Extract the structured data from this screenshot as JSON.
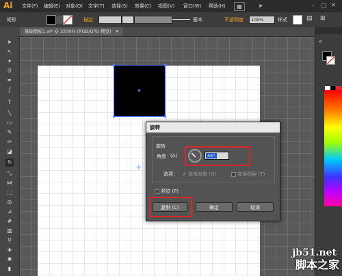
{
  "app": {
    "logo": "Ai"
  },
  "menu": [
    "文件(F)",
    "编辑(E)",
    "对象(O)",
    "文字(T)",
    "选择(S)",
    "效果(C)",
    "视图(V)",
    "窗口(W)",
    "帮助(H)"
  ],
  "control_bar": {
    "object_type": "矩形",
    "stroke_label": "描边",
    "stroke_style": "基本",
    "opacity_label": "不透明度",
    "opacity_value": "100%",
    "style_label": "样式"
  },
  "document": {
    "tab_title": "基础图标1.ai* @ 3200% (RGB/GPU 预览)"
  },
  "dialog": {
    "title": "旋转",
    "group_label": "旋转",
    "angle_label": "角度",
    "angle_shortcut": "(A)",
    "angle_value": "45°",
    "options_label": "选项：",
    "transform_objects": "变换对象",
    "transform_objects_key": "(O)",
    "transform_patterns": "变换图案",
    "transform_patterns_key": "(T)",
    "preview_label": "预览",
    "preview_key": "(P)",
    "copy_button": "复制",
    "copy_key": "(C)",
    "ok_button": "确定",
    "cancel_button": "取消"
  },
  "watermark": {
    "site": "jb51.net",
    "name": "脚本之家"
  },
  "colors": {
    "accent": "#e0252b",
    "selection": "#4a78ff",
    "logo": "#f7a21b"
  }
}
